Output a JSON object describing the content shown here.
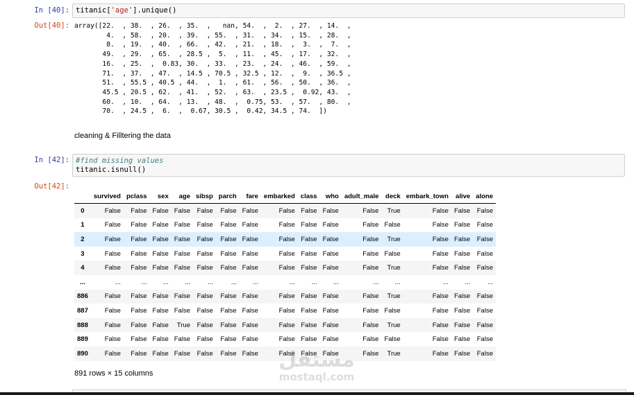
{
  "cell40": {
    "in_prompt": "In [40]:",
    "code": "titanic['age'].unique()",
    "out_prompt": "Out[40]:",
    "output_lines": [
      "array([22.  , 38.  , 26.  , 35.  ,   nan, 54.  ,  2.  , 27.  , 14.  ,",
      "        4.  , 58.  , 20.  , 39.  , 55.  , 31.  , 34.  , 15.  , 28.  ,",
      "        8.  , 19.  , 40.  , 66.  , 42.  , 21.  , 18.  ,  3.  ,  7.  ,",
      "       49.  , 29.  , 65.  , 28.5 ,  5.  , 11.  , 45.  , 17.  , 32.  ,",
      "       16.  , 25.  ,  0.83, 30.  , 33.  , 23.  , 24.  , 46.  , 59.  ,",
      "       71.  , 37.  , 47.  , 14.5 , 70.5 , 32.5 , 12.  ,  9.  , 36.5 ,",
      "       51.  , 55.5 , 40.5 , 44.  ,  1.  , 61.  , 56.  , 50.  , 36.  ,",
      "       45.5 , 20.5 , 62.  , 41.  , 52.  , 63.  , 23.5 ,  0.92, 43.  ,",
      "       60.  , 10.  , 64.  , 13.  , 48.  ,  0.75, 53.  , 57.  , 80.  ,",
      "       70.  , 24.5 ,  6.  ,  0.67, 30.5 ,  0.42, 34.5 , 74.  ])"
    ]
  },
  "markdown": {
    "text": "cleaning & Filltering the data"
  },
  "cell42": {
    "in_prompt": "In [42]:",
    "comment": "#find missing values",
    "code": "titanic.isnull()",
    "out_prompt": "Out[42]:",
    "columns": [
      "survived",
      "pclass",
      "sex",
      "age",
      "sibsp",
      "parch",
      "fare",
      "embarked",
      "class",
      "who",
      "adult_male",
      "deck",
      "embark_town",
      "alive",
      "alone"
    ],
    "rows": [
      {
        "index": "0",
        "cells": [
          "False",
          "False",
          "False",
          "False",
          "False",
          "False",
          "False",
          "False",
          "False",
          "False",
          "False",
          "True",
          "False",
          "False",
          "False"
        ]
      },
      {
        "index": "1",
        "cells": [
          "False",
          "False",
          "False",
          "False",
          "False",
          "False",
          "False",
          "False",
          "False",
          "False",
          "False",
          "False",
          "False",
          "False",
          "False"
        ]
      },
      {
        "index": "2",
        "cells": [
          "False",
          "False",
          "False",
          "False",
          "False",
          "False",
          "False",
          "False",
          "False",
          "False",
          "False",
          "True",
          "False",
          "False",
          "False"
        ]
      },
      {
        "index": "3",
        "cells": [
          "False",
          "False",
          "False",
          "False",
          "False",
          "False",
          "False",
          "False",
          "False",
          "False",
          "False",
          "False",
          "False",
          "False",
          "False"
        ]
      },
      {
        "index": "4",
        "cells": [
          "False",
          "False",
          "False",
          "False",
          "False",
          "False",
          "False",
          "False",
          "False",
          "False",
          "False",
          "True",
          "False",
          "False",
          "False"
        ]
      },
      {
        "index": "...",
        "cells": [
          "...",
          "...",
          "...",
          "...",
          "...",
          "...",
          "...",
          "...",
          "...",
          "...",
          "...",
          "...",
          "...",
          "...",
          "..."
        ]
      },
      {
        "index": "886",
        "cells": [
          "False",
          "False",
          "False",
          "False",
          "False",
          "False",
          "False",
          "False",
          "False",
          "False",
          "False",
          "True",
          "False",
          "False",
          "False"
        ]
      },
      {
        "index": "887",
        "cells": [
          "False",
          "False",
          "False",
          "False",
          "False",
          "False",
          "False",
          "False",
          "False",
          "False",
          "False",
          "False",
          "False",
          "False",
          "False"
        ]
      },
      {
        "index": "888",
        "cells": [
          "False",
          "False",
          "False",
          "True",
          "False",
          "False",
          "False",
          "False",
          "False",
          "False",
          "False",
          "True",
          "False",
          "False",
          "False"
        ]
      },
      {
        "index": "889",
        "cells": [
          "False",
          "False",
          "False",
          "False",
          "False",
          "False",
          "False",
          "False",
          "False",
          "False",
          "False",
          "False",
          "False",
          "False",
          "False"
        ]
      },
      {
        "index": "890",
        "cells": [
          "False",
          "False",
          "False",
          "False",
          "False",
          "False",
          "False",
          "False",
          "False",
          "False",
          "False",
          "True",
          "False",
          "False",
          "False"
        ]
      }
    ],
    "summary": "891 rows × 15 columns"
  },
  "watermark": {
    "arabic": "مستقل",
    "latin": "mostaql.com"
  }
}
